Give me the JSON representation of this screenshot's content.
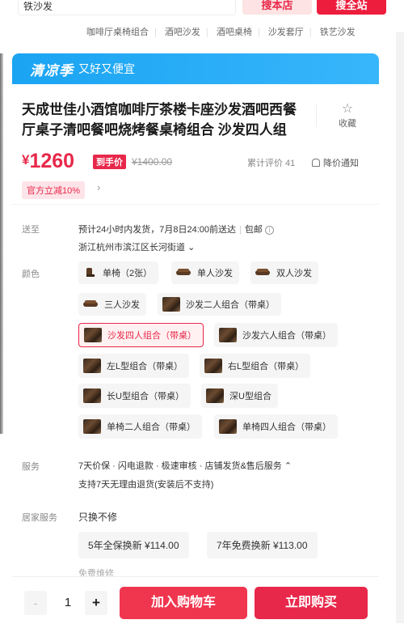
{
  "search": {
    "value": "铁沙发",
    "store_button": "搜本店",
    "all_button": "搜全站"
  },
  "hotwords": [
    "咖啡厅桌椅组合",
    "酒吧沙发",
    "酒吧桌椅",
    "沙发套厅",
    "铁艺沙发"
  ],
  "promo": {
    "title": "清凉季",
    "subtitle": "又好又便宜",
    "color": "#1aa4f2"
  },
  "product": {
    "title": "天成世佳小酒馆咖啡厅茶楼卡座沙发酒吧西餐厅桌子清吧餐吧烧烤餐桌椅组合 沙发四人组",
    "favorite_label": "收藏",
    "currency": "¥",
    "price": "1260",
    "price_badge": "到手价",
    "original_price": "¥1400.00",
    "reviews": "累计评价 41",
    "notify_label": "降价通知",
    "coupon": "官方立减10%",
    "accent_color": "#e8284a"
  },
  "shipping": {
    "label": "送至",
    "estimate": "预计24小时内发货，7月8日24:00前送达",
    "free_shipping": "包邮",
    "address": "浙江杭州市滨江区长河街道"
  },
  "colors": {
    "label": "颜色",
    "options": [
      "单椅（2张）",
      "单人沙发",
      "双人沙发",
      "三人沙发",
      "沙发二人组合（带桌）",
      "沙发四人组合（带桌）",
      "沙发六人组合（带桌）",
      "左L型组合（带桌）",
      "右L型组合（带桌）",
      "长U型组合（带桌）",
      "深U型组合",
      "单椅二人组合（带桌）",
      "单椅四人组合（带桌）"
    ],
    "selected": "沙发四人组合（带桌）"
  },
  "service": {
    "label": "服务",
    "line1": "7天价保 · 闪电退款 · 极速审核 · 店铺发货&售后服务",
    "line2": "支持7天无理由退货(安装后不支持)"
  },
  "home_service": {
    "label": "居家服务",
    "value": "只换不修",
    "plans": [
      "5年全保换新 ¥114.00",
      "7年免费换新 ¥113.00"
    ],
    "more": "免费维修"
  },
  "actions": {
    "quantity": "1",
    "minus": "-",
    "plus": "+",
    "add_to_cart": "加入购物车",
    "buy_now": "立即购买"
  }
}
